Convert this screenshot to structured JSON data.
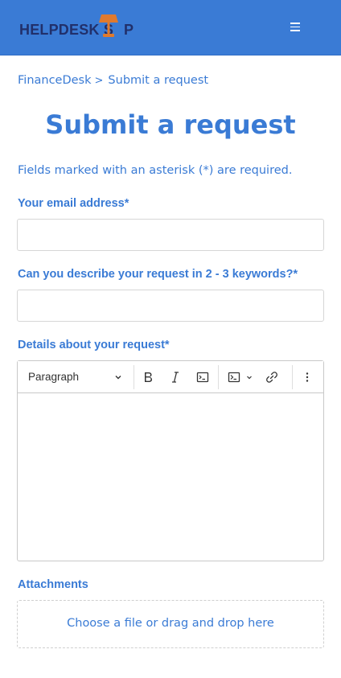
{
  "header": {
    "logo_text_left": "HELPDESK S",
    "logo_text_right": "P",
    "logo_icon": "lamp-icon",
    "menu_icon": "hamburger-menu-icon",
    "colors": {
      "bar": "#3a7bd5",
      "logo_text": "#21306b",
      "lamp": "#e07a2e"
    }
  },
  "breadcrumb": {
    "items": [
      "FinanceDesk",
      "Submit a request"
    ],
    "separator": ">"
  },
  "page": {
    "title": "Submit a request",
    "required_note": "Fields marked with an asterisk (*) are required."
  },
  "form": {
    "email": {
      "label": "Your email address*",
      "value": "",
      "placeholder": ""
    },
    "subject": {
      "label": "Can you describe your request in 2 - 3 keywords?*",
      "value": "",
      "placeholder": ""
    },
    "details": {
      "label": "Details about your request*",
      "toolbar": {
        "paragraph_style": "Paragraph",
        "icons": [
          "bold-icon",
          "italic-icon",
          "code-block-icon",
          "insert-code-icon",
          "link-icon",
          "more-options-icon"
        ]
      }
    },
    "attachments": {
      "label": "Attachments",
      "dropzone_text": "Choose a file or drag and drop here"
    }
  },
  "colors": {
    "accent": "#3a7bd5",
    "border": "#d6d6d6"
  }
}
